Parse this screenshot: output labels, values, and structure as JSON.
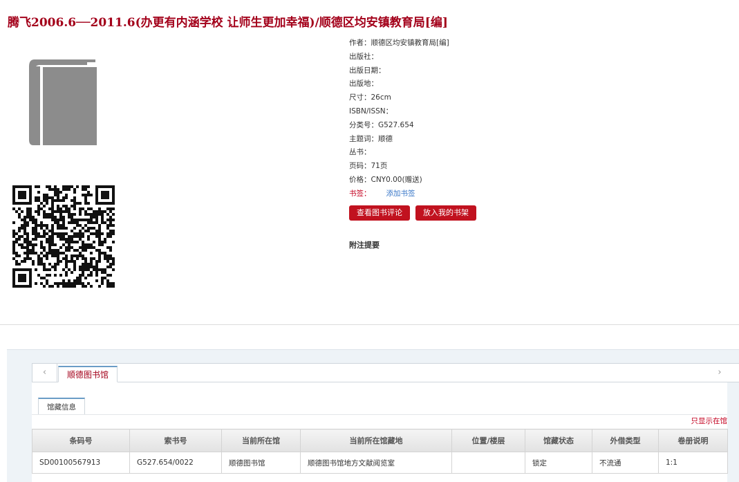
{
  "page": {
    "title": "腾飞2006.6──2011.6(办更有内涵学校 让师生更加幸福)/顺德区均安镇教育局[编]"
  },
  "meta": [
    {
      "label": "作者：",
      "value": "顺德区均安镇教育局[编]"
    },
    {
      "label": "出版社：",
      "value": ""
    },
    {
      "label": "出版日期：",
      "value": ""
    },
    {
      "label": "出版地：",
      "value": ""
    },
    {
      "label": "尺寸：",
      "value": "26cm"
    },
    {
      "label": "ISBN/ISSN：",
      "value": ""
    },
    {
      "label": "分类号：",
      "value": "G527.654"
    },
    {
      "label": "主题词：",
      "value": "顺德"
    },
    {
      "label": "丛书：",
      "value": ""
    },
    {
      "label": "页码：",
      "value": "71页"
    },
    {
      "label": "价格：",
      "value": "CNY0.00(赠送)"
    }
  ],
  "bookmark": {
    "label": "书签：",
    "add_link": "添加书签"
  },
  "buttons": {
    "review": "查看图书评论",
    "shelf": "放入我的书架"
  },
  "notes_heading": "附注提要",
  "holdings": {
    "library_tab": "顺德图书馆",
    "prev_arrow": "‹",
    "next_arrow": "›",
    "sub_tab": "馆藏信息",
    "only_available": "只显示在馆",
    "columns": [
      "条码号",
      "索书号",
      "当前所在馆",
      "当前所在馆藏地",
      "位置/楼层",
      "馆藏状态",
      "外借类型",
      "卷册说明"
    ],
    "rows": [
      [
        "SD00100567913",
        "G527.654/0022",
        "顺德图书馆",
        "顺德图书馆地方文献阅览室",
        "",
        "锁定",
        "不流通",
        "1:1"
      ]
    ]
  },
  "colors": {
    "accent": "#a3001a",
    "button": "#c1121f",
    "link": "#3a78c8"
  },
  "icons": {
    "book": "book-icon",
    "qr": "qr-code-icon"
  }
}
